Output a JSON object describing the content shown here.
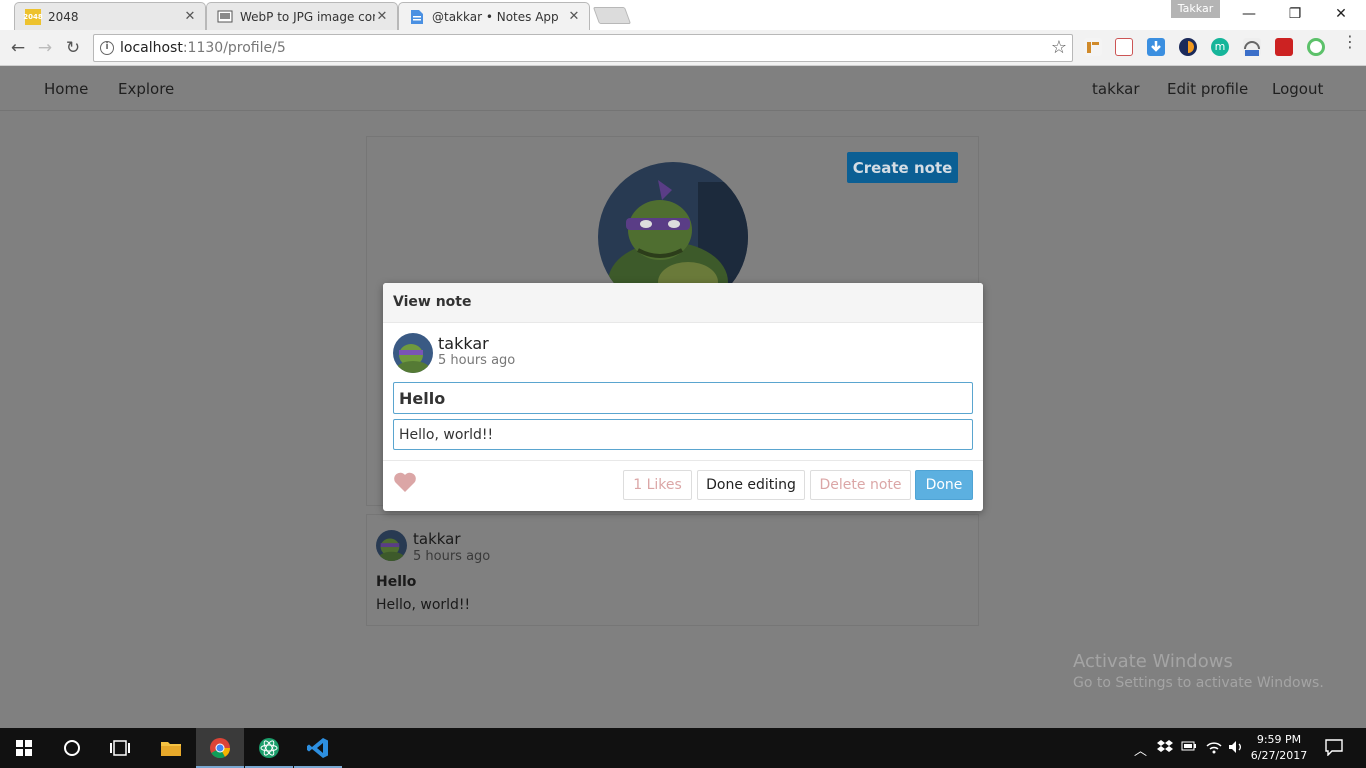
{
  "browser": {
    "tabs": [
      {
        "title": "2048",
        "favicon_text": "2048"
      },
      {
        "title": "WebP to JPG image conv"
      },
      {
        "title": "@takkar • Notes App"
      }
    ],
    "profile_name": "Takkar",
    "url": {
      "host": "localhost",
      "path": ":1130/profile/5"
    },
    "window_controls": {
      "minimize": "—",
      "maximize": "❐",
      "close": "✕"
    }
  },
  "nav": {
    "home": "Home",
    "explore": "Explore",
    "user": "takkar",
    "edit_profile": "Edit profile",
    "logout": "Logout"
  },
  "profile": {
    "create_note_label": "Create note"
  },
  "note_card": {
    "user": "takkar",
    "time": "5 hours ago",
    "title": "Hello",
    "body": "Hello, world!!"
  },
  "modal": {
    "header": "View note",
    "user": "takkar",
    "time": "5 hours ago",
    "title_value": "Hello",
    "body_value": "Hello, world!!",
    "likes_label": "1 Likes",
    "done_editing_label": "Done editing",
    "delete_label": "Delete note",
    "done_label": "Done"
  },
  "watermark": {
    "line1": "Activate Windows",
    "line2": "Go to Settings to activate Windows."
  },
  "taskbar": {
    "time": "9:59 PM",
    "date": "6/27/2017"
  },
  "colors": {
    "accent": "#5cb0e0",
    "primary_button": "#0b5f94",
    "backdrop": "#808080",
    "like_heart": "#dba6a6"
  }
}
